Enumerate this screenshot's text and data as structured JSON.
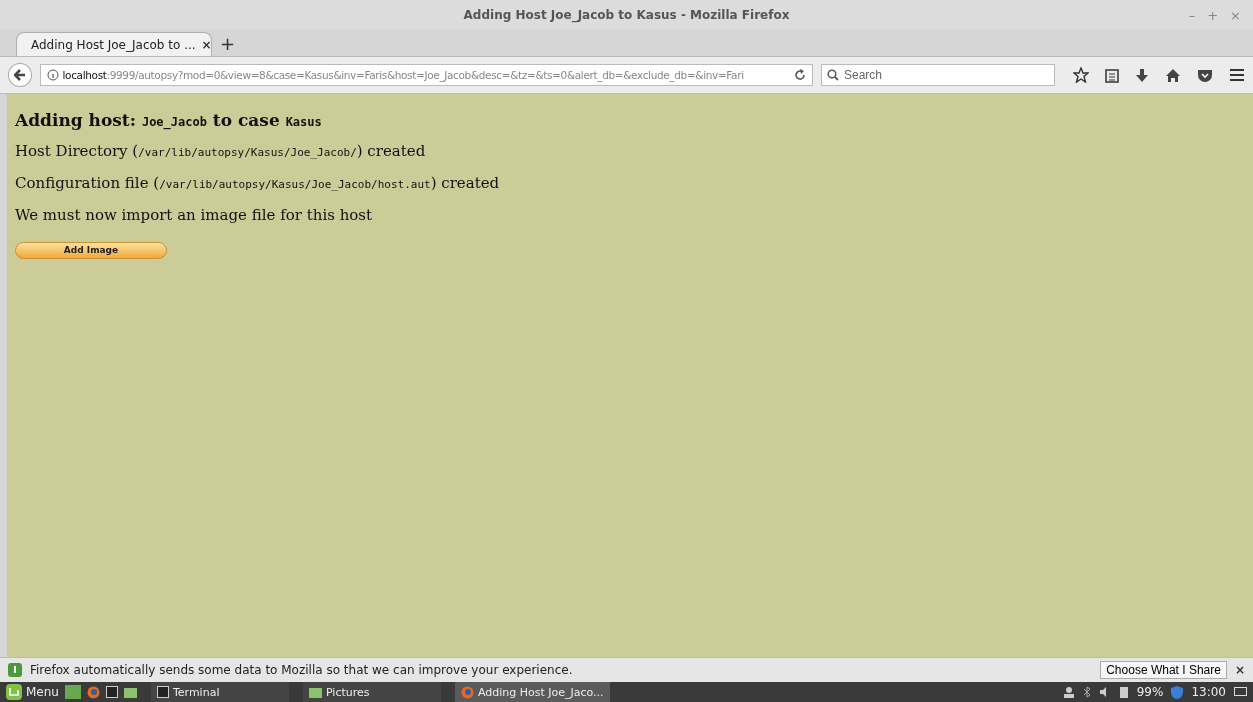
{
  "window": {
    "title": "Adding Host Joe_Jacob to Kasus - Mozilla Firefox",
    "controls": [
      "–",
      "+",
      "×"
    ]
  },
  "tabs": [
    {
      "label": "Adding Host Joe_Jacob to ...",
      "selected": true,
      "close": "×"
    }
  ],
  "new_tab": "+",
  "address_bar": {
    "host": "localhost",
    "rest": ":9999/autopsy?mod=0&view=8&case=Kasus&inv=Faris&host=Joe_Jacob&desc=&tz=&ts=0&alert_db=&exclude_db=&inv=Fari"
  },
  "search": {
    "placeholder": "Search"
  },
  "page": {
    "heading": [
      {
        "kind": "text",
        "text": "Adding host: "
      },
      {
        "kind": "code",
        "text": "Joe_Jacob"
      },
      {
        "kind": "text",
        "text": " to case "
      },
      {
        "kind": "code",
        "text": "Kasus"
      }
    ],
    "lines": [
      [
        {
          "kind": "text",
          "text": "Host Directory ("
        },
        {
          "kind": "code",
          "text": "/var/lib/autopsy/Kasus/Joe_Jacob/"
        },
        {
          "kind": "text",
          "text": ") created"
        }
      ],
      [
        {
          "kind": "text",
          "text": "Configuration file ("
        },
        {
          "kind": "code",
          "text": "/var/lib/autopsy/Kasus/Joe_Jacob/host.aut"
        },
        {
          "kind": "text",
          "text": ") created"
        }
      ],
      [
        {
          "kind": "text",
          "text": "We must now import an image file for this host"
        }
      ]
    ],
    "button": "Add Image"
  },
  "notification": {
    "text": "Firefox automatically sends some data to Mozilla so that we can improve your experience.",
    "button": "Choose What I Share",
    "close": "×"
  },
  "taskbar": {
    "menu": "Menu",
    "windows": [
      {
        "label": "Terminal",
        "selected": false,
        "kind": "terminal"
      },
      {
        "label": "Pictures",
        "selected": false,
        "kind": "folder"
      },
      {
        "label": "Adding Host Joe_Jaco...",
        "selected": true,
        "kind": "firefox"
      }
    ],
    "battery": "99%",
    "clock": "13:00"
  }
}
